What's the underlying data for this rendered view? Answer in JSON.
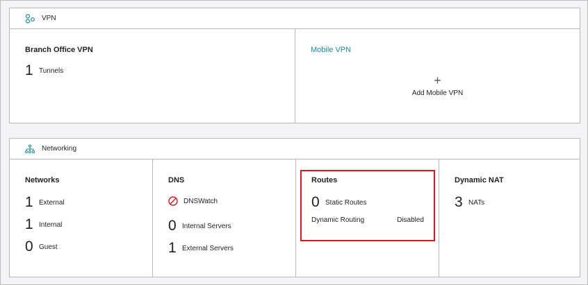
{
  "vpn": {
    "header": "VPN",
    "branch": {
      "title": "Branch Office VPN",
      "count": "1",
      "label": "Tunnels"
    },
    "mobile": {
      "title": "Mobile VPN",
      "add_icon": "+",
      "add_label": "Add Mobile VPN"
    }
  },
  "networking": {
    "header": "Networking",
    "networks": {
      "title": "Networks",
      "items": [
        {
          "count": "1",
          "label": "External"
        },
        {
          "count": "1",
          "label": "Internal"
        },
        {
          "count": "0",
          "label": "Guest"
        }
      ]
    },
    "dns": {
      "title": "DNS",
      "dnswatch": "DNSWatch",
      "items": [
        {
          "count": "0",
          "label": "Internal Servers"
        },
        {
          "count": "1",
          "label": "External Servers"
        }
      ]
    },
    "routes": {
      "title": "Routes",
      "count": "0",
      "label": "Static Routes",
      "dynamic_label": "Dynamic Routing",
      "dynamic_value": "Disabled"
    },
    "nat": {
      "title": "Dynamic NAT",
      "count": "3",
      "label": "NATs"
    }
  },
  "colors": {
    "accent": "#1a8a9a",
    "highlight": "#e0141e"
  }
}
